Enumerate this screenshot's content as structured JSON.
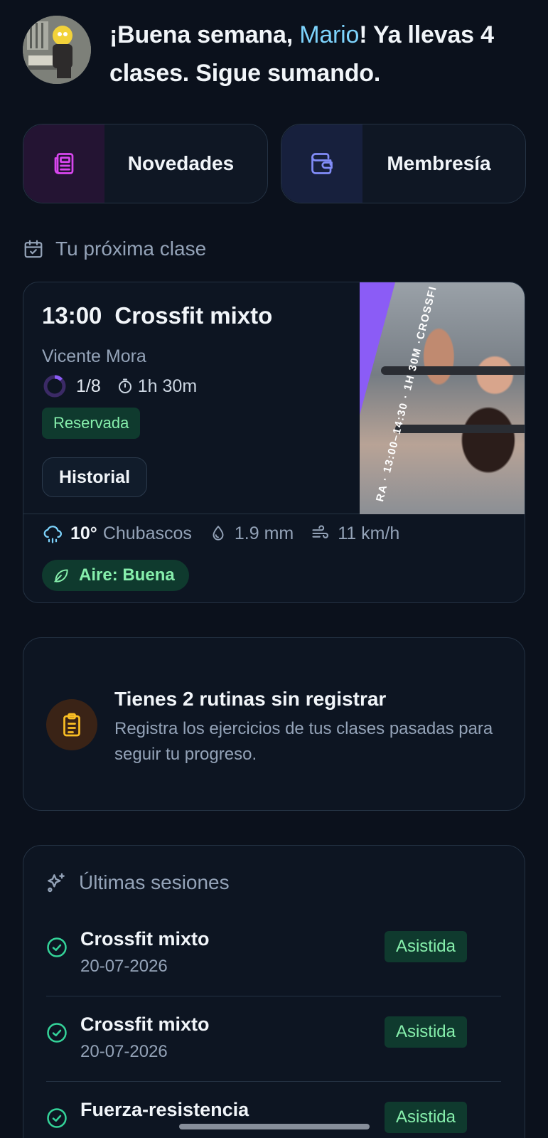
{
  "header": {
    "greeting_prefix": "¡Buena semana, ",
    "user_name": "Mario",
    "greeting_suffix": "! Ya llevas 4 clases. Sigue sumando."
  },
  "quick_actions": [
    {
      "label": "Novedades",
      "icon": "newspaper-icon",
      "color": "#d946ef"
    },
    {
      "label": "Membresía",
      "icon": "wallet-icon",
      "color": "#818cf8"
    }
  ],
  "next_class": {
    "section_title": "Tu próxima clase",
    "time": "13:00",
    "name": "Crossfit mixto",
    "coach": "Vicente Mora",
    "occupancy": "1/8",
    "occupancy_fraction": 0.125,
    "duration": "1h 30m",
    "status": "Reservada",
    "history_button": "Historial",
    "banner_text": "RA · 13:00–14:30 · 1H 30M ·CROSSFI",
    "accent": "#8b5cf6",
    "weather": {
      "temp": "10°",
      "condition": "Chubascos",
      "rain": "1.9 mm",
      "wind": "11 km/h",
      "air_quality": "Aire: Buena"
    }
  },
  "routines": {
    "title": "Tienes 2 rutinas sin registrar",
    "description": "Registra los ejercicios de tus clases pasadas para seguir tu progreso."
  },
  "sessions": {
    "title": "Últimas sesiones",
    "items": [
      {
        "name": "Crossfit mixto",
        "date": "20-07-2026",
        "status": "Asistida"
      },
      {
        "name": "Crossfit mixto",
        "date": "20-07-2026",
        "status": "Asistida"
      },
      {
        "name": "Fuerza-resistencia",
        "date": "",
        "status": "Asistida"
      }
    ]
  }
}
